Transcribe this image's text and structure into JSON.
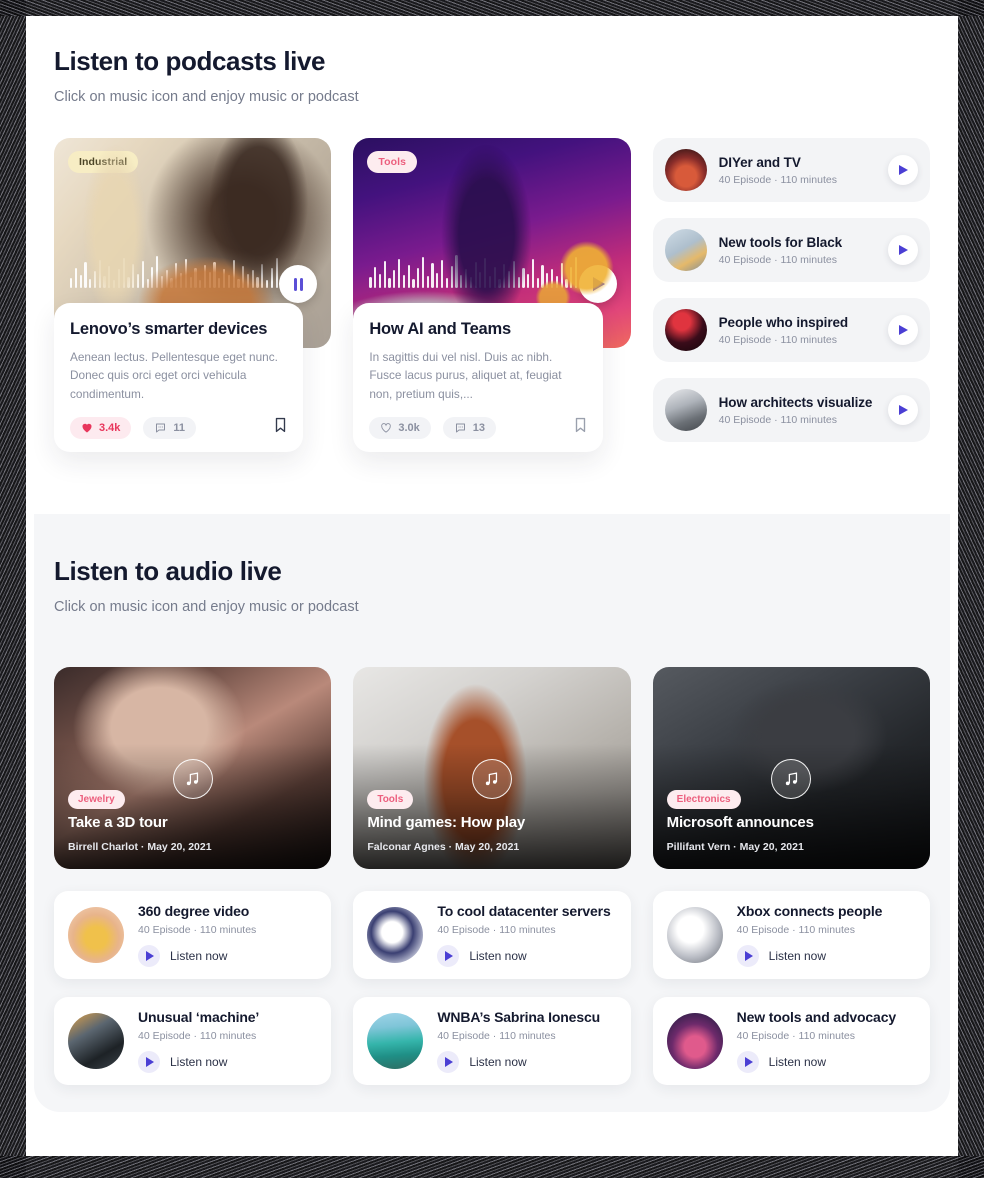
{
  "podcast_section": {
    "title": "Listen to podcasts live",
    "subtitle": "Click on music icon and enjoy music or podcast",
    "cards": [
      {
        "badge": "Industrial",
        "title": "Lenovo’s smarter devices",
        "description": "Aenean lectus. Pellentesque eget nunc. Donec quis orci eget orci vehicula condimentum.",
        "likes": "3.4k",
        "comments": "11",
        "player_state": "pause"
      },
      {
        "badge": "Tools",
        "title": "How AI and Teams",
        "description": "In sagittis dui vel nisl. Duis ac nibh. Fusce lacus purus, aliquet at, feugiat non, pretium quis,...",
        "likes": "3.0k",
        "comments": "13",
        "player_state": "play"
      }
    ],
    "list": [
      {
        "title": "DIYer and TV",
        "meta": "40 Episode · 110 minutes"
      },
      {
        "title": "New tools for Black",
        "meta": "40 Episode · 110 minutes"
      },
      {
        "title": "People who inspired",
        "meta": "40 Episode · 110 minutes"
      },
      {
        "title": "How architects visualize",
        "meta": "40 Episode · 110 minutes"
      }
    ]
  },
  "audio_section": {
    "title": "Listen to audio live",
    "subtitle": "Click on music icon and enjoy music or podcast",
    "cards": [
      {
        "badge": "Jewelry",
        "title": "Take a 3D tour",
        "meta": "Birrell Charlot  ·  May 20, 2021"
      },
      {
        "badge": "Tools",
        "title": "Mind games: How play",
        "meta": "Falconar Agnes  ·  May 20, 2021"
      },
      {
        "badge": "Electronics",
        "title": "Microsoft announces",
        "meta": "Pillifant Vern  ·  May 20, 2021"
      }
    ],
    "items": [
      {
        "title": "360 degree video",
        "meta": "40 Episode · 110 minutes",
        "action": "Listen now"
      },
      {
        "title": "To cool datacenter servers",
        "meta": "40 Episode · 110 minutes",
        "action": "Listen now"
      },
      {
        "title": "Xbox connects people",
        "meta": "40 Episode · 110 minutes",
        "action": "Listen now"
      },
      {
        "title": "Unusual ‘machine’",
        "meta": "40 Episode · 110 minutes",
        "action": "Listen now"
      },
      {
        "title": "WNBA’s Sabrina Ionescu",
        "meta": "40 Episode · 110 minutes",
        "action": "Listen now"
      },
      {
        "title": "New tools and advocacy",
        "meta": "40 Episode · 110 minutes",
        "action": "Listen now"
      }
    ]
  },
  "icons": {
    "music_note": "♫",
    "heart_filled": "♥",
    "heart_outline": "♡",
    "comment": "💬",
    "bookmark": "bookmark-icon"
  },
  "colors": {
    "accent_purple": "#4b3fd4",
    "like_red": "#e8365c",
    "tag_pink_bg": "#fdecef",
    "tag_yellow_bg": "#f7edc4",
    "page_bg": "#f5f6f8"
  }
}
